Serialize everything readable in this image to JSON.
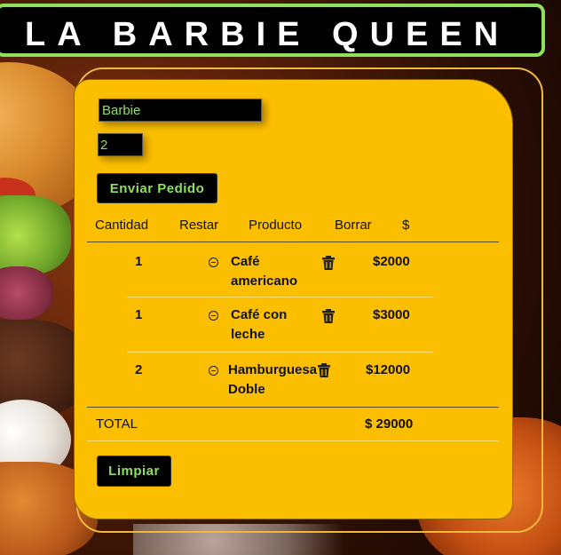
{
  "header": {
    "title": "LA BARBIE QUEEN"
  },
  "form": {
    "name_value": "Barbie",
    "quantity_value": "2",
    "send_label": "Enviar Pedido"
  },
  "table": {
    "headers": [
      "Cantidad",
      "Restar",
      "Producto",
      "Borrar",
      "$"
    ],
    "rows": [
      {
        "qty": "1",
        "product_line1": "Café",
        "product_line2": "americano",
        "price": "$2000"
      },
      {
        "qty": "1",
        "product_line1": "Café con",
        "product_line2": "leche",
        "price": "$3000"
      },
      {
        "qty": "2",
        "product_line1": "Hamburguesa",
        "product_line2": "Doble",
        "price": "$12000"
      }
    ],
    "total_label": "TOTAL",
    "total_value": "$ 29000"
  },
  "actions": {
    "clear_label": "Limpiar"
  },
  "colors": {
    "accent": "#8fe05a",
    "card": "#fcbf00",
    "header_bg": "#000000"
  },
  "icons": {
    "restar": "minus-circle-icon",
    "borrar": "trash-icon"
  }
}
